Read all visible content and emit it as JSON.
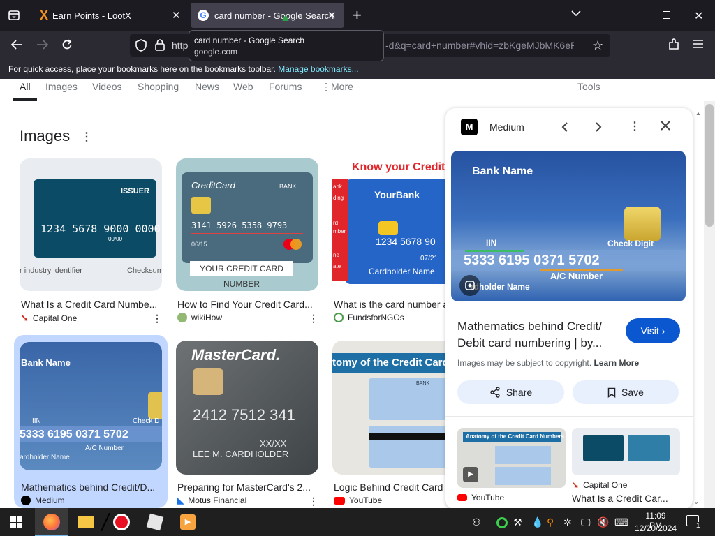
{
  "browser": {
    "tabs": [
      {
        "title": "Earn Points - LootX",
        "icon": "lootx-x-icon"
      },
      {
        "title": "card number - Google Search",
        "icon": "google-g-icon"
      }
    ],
    "url": "https://www.google.com/search?q=card+number&tbm=isch&sca_esv=...d&q=card+number#vhid=zbKgeMJbMK6ePM",
    "url_visible_left": "http",
    "url_visible_right": "-d&q=card+number#vhid=zbKgeMJbMK6ePM",
    "tooltip": {
      "title": "card number - Google Search",
      "domain": "google.com"
    },
    "bookmarks_bar_text": "For quick access, place your bookmarks here on the bookmarks toolbar.",
    "bookmarks_bar_link": "Manage bookmarks..."
  },
  "search_tabs": [
    "All",
    "Images",
    "Videos",
    "Shopping",
    "News",
    "Web",
    "Forums",
    "More"
  ],
  "tools_label": "Tools",
  "images_section_title": "Images",
  "results": [
    {
      "caption": "What Is a Credit Card Numbe...",
      "source": "Capital One",
      "card_text": "1234 5678 9000 0000",
      "issuer": "ISSUER",
      "exp": "00/00",
      "left_label": "r industry identifier",
      "right_label": "Checksum"
    },
    {
      "caption": "How to Find Your Credit Card...",
      "source": "wikiHow",
      "card_brand": "CreditCard",
      "bank": "BANK",
      "card_text": "3141 5926 5358 9793",
      "exp": "06/15",
      "banner": "YOUR CREDIT CARD NUMBER"
    },
    {
      "caption": "What is the card number a",
      "source": "FundsforNGOs",
      "header": "Know your Credit",
      "bank": "YourBank",
      "card_text": "1234 5678 90",
      "exp": "07/21",
      "holder": "Cardholder Name",
      "side1": "ank",
      "side2": "ding",
      "side3": "rd",
      "side4": "mber",
      "side5": "ne",
      "side6": "ate"
    },
    {
      "caption": "Mathematics behind Credit/D...",
      "source": "Medium",
      "bank": "Bank Name",
      "iin": "IIN",
      "check": "Check D",
      "card_text": "5333 6195 0371 5702",
      "acct": "A/C Number",
      "holder": "ardholder Name"
    },
    {
      "caption": "Preparing for MasterCard's 2...",
      "source": "Motus Financial",
      "brand": "MasterCard.",
      "card_text": "2412 7512 341",
      "exp": "XX/XX",
      "holder": "LEE M. CARDHOLDER"
    },
    {
      "caption": "Logic Behind Credit Card",
      "source": "YouTube",
      "header": "tomy of the Credit Card",
      "bank": "BANK"
    }
  ],
  "panel": {
    "site": "Medium",
    "card": {
      "bank": "Bank Name",
      "iin": "IIN",
      "check": "Check Digit",
      "number": "5333 6195 0371 5702",
      "acct": "A/C Number",
      "holder": "rdholder Name"
    },
    "title": "Mathematics behind Credit/ Debit card numbering | by...",
    "visit_label": "Visit",
    "copyright": "Images may be subject to copyright.",
    "learn_more": "Learn More",
    "share_label": "Share",
    "save_label": "Save",
    "related": [
      {
        "source": "YouTube",
        "thumb_header": "Anatomy of the Credit Card Numbers"
      },
      {
        "source": "Capital One",
        "caption": "What Is a Credit Car..."
      }
    ]
  },
  "taskbar": {
    "time": "11:09 PM",
    "date": "12/20/2024",
    "notification_count": "1"
  },
  "colors": {
    "tab_bar": "#1c1b22",
    "nav_bar": "#2b2a33",
    "active_tab": "#42414d",
    "link_cyan": "#80ebff",
    "google_blue": "#0b57d0",
    "selected_highlight": "#c2d7ff"
  }
}
